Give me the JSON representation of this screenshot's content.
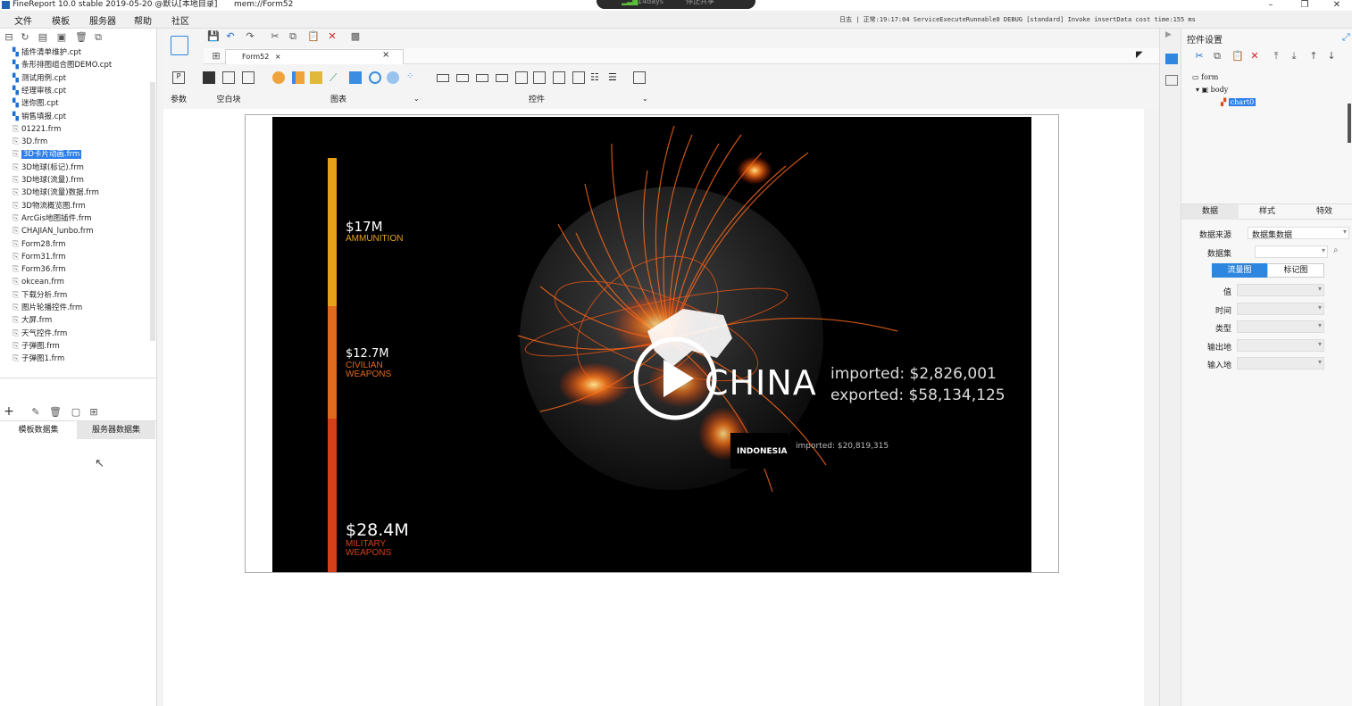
{
  "titlebar": {
    "title": "FineReport 10.0 stable 2019-05-20 @默认[本地目录]",
    "file": "mem://Form52",
    "pill_left": "14days",
    "pill_right": "停止共享"
  },
  "menu": [
    "文件",
    "模板",
    "服务器",
    "帮助",
    "社区"
  ],
  "log_text": "日志 | 正常:19:17:04 ServiceExecuteRunnable0 DEBUG [standard] Invoke insertData cost time:155 ms",
  "files": [
    {
      "name": "插件清单维护.cpt",
      "kind": "cpt"
    },
    {
      "name": "条形排图组合图DEMO.cpt",
      "kind": "cpt"
    },
    {
      "name": "测试用例.cpt",
      "kind": "cpt"
    },
    {
      "name": "经理审核.cpt",
      "kind": "cpt"
    },
    {
      "name": "迷你图.cpt",
      "kind": "cpt"
    },
    {
      "name": "销售填报.cpt",
      "kind": "cpt"
    },
    {
      "name": "01221.frm",
      "kind": "frm"
    },
    {
      "name": "3D.frm",
      "kind": "frm"
    },
    {
      "name": "3D卡片动画.frm",
      "kind": "frm",
      "selected": true
    },
    {
      "name": "3D地球(标记).frm",
      "kind": "frm"
    },
    {
      "name": "3D地球(流量).frm",
      "kind": "frm"
    },
    {
      "name": "3D地球(流量)数据.frm",
      "kind": "frm"
    },
    {
      "name": "3D物流概览图.frm",
      "kind": "frm"
    },
    {
      "name": "ArcGis地图插件.frm",
      "kind": "frm"
    },
    {
      "name": "CHAJIAN_lunbo.frm",
      "kind": "frm"
    },
    {
      "name": "Form28.frm",
      "kind": "frm"
    },
    {
      "name": "Form31.frm",
      "kind": "frm"
    },
    {
      "name": "Form36.frm",
      "kind": "frm"
    },
    {
      "name": "okcean.frm",
      "kind": "frm"
    },
    {
      "name": "下载分析.frm",
      "kind": "frm"
    },
    {
      "name": "图片轮播控件.frm",
      "kind": "frm"
    },
    {
      "name": "大屏.frm",
      "kind": "frm"
    },
    {
      "name": "天气控件.frm",
      "kind": "frm"
    },
    {
      "name": "子弹图.frm",
      "kind": "frm"
    },
    {
      "name": "子弹图1.frm",
      "kind": "frm"
    }
  ],
  "left_tabs": {
    "template": "模板数据集",
    "server": "服务器数据集"
  },
  "doc_tab": "Form52",
  "insert_groups": {
    "param": "参数",
    "blank": "空白块",
    "chart": "图表",
    "widget": "控件"
  },
  "chart_overlay": {
    "amounts": [
      {
        "value": "$17M",
        "label": "AMMUNITION",
        "color": "#e8a21a"
      },
      {
        "value": "$12.7M",
        "label": "CIVILIAN WEAPONS",
        "color": "#e06a1e"
      },
      {
        "value": "$28.4M",
        "label": "MILITARY WEAPONS",
        "color": "#d4401a"
      }
    ],
    "country": "CHINA",
    "imported": "imported: $2,826,001",
    "exported": "exported: $58,134,125",
    "sub_country": "INDONESIA",
    "sub_imported": "imported: $20,819,315"
  },
  "right_panel": {
    "title": "控件设置",
    "tree": [
      "form",
      "body",
      "chart0"
    ],
    "tabs": [
      "数据",
      "样式",
      "特效"
    ],
    "data_source_label": "数据来源",
    "data_source_value": "数据集数据",
    "dataset_label": "数据集",
    "toggle": [
      "流量图",
      "标记图"
    ],
    "fields": [
      "值",
      "时间",
      "类型",
      "输出地",
      "输入地"
    ]
  },
  "colors": {
    "accent": "#2e86de",
    "selected": "#2f7fe8"
  }
}
